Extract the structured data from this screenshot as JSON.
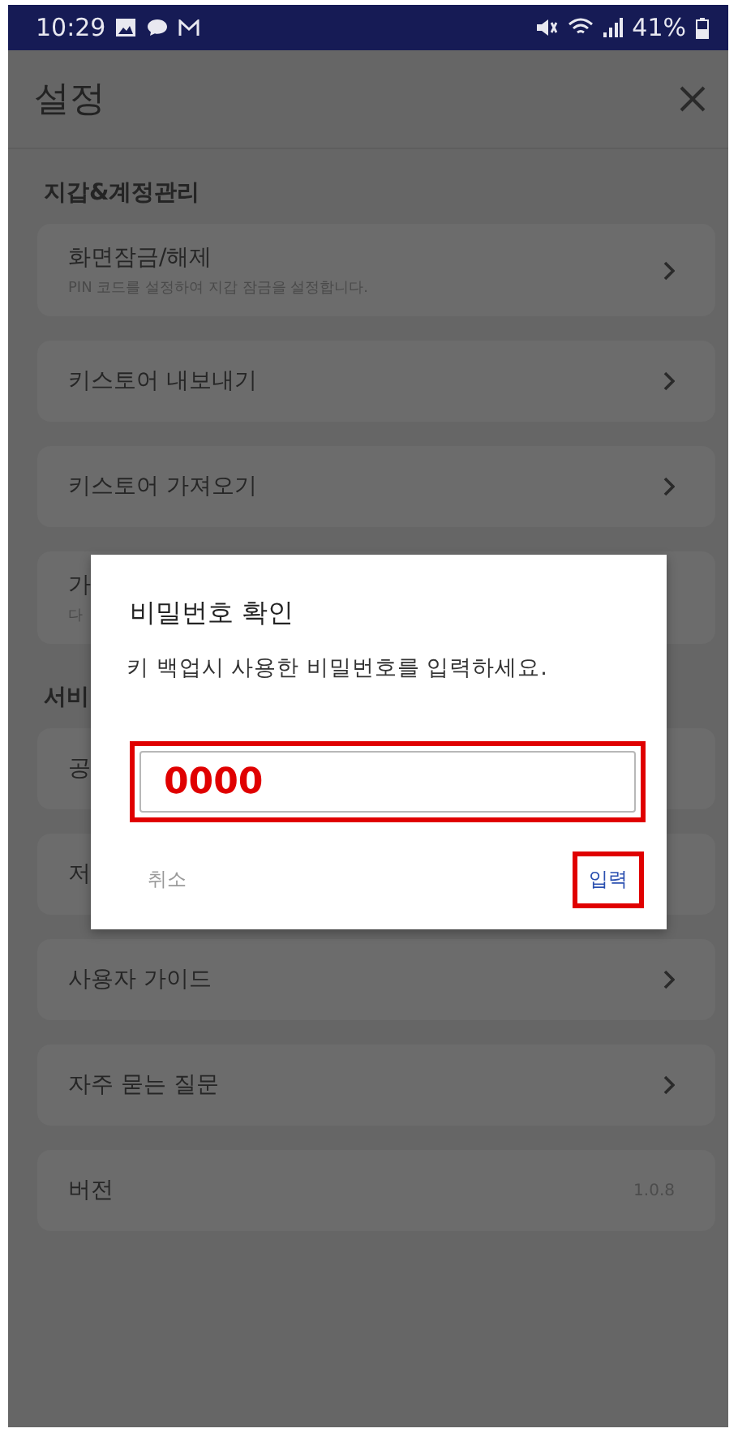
{
  "status_bar": {
    "time": "10:29",
    "battery": "41%"
  },
  "header": {
    "title": "설정"
  },
  "sections": [
    {
      "title": "지갑&계정관리",
      "items": [
        {
          "kind": "nav",
          "label": "화면잠금/해제",
          "subtitle": "PIN 코드를 설정하여 지갑 잠금을 설정합니다."
        },
        {
          "kind": "nav",
          "label": "키스토어 내보내기"
        },
        {
          "kind": "nav",
          "label": "키스토어 가져오기"
        },
        {
          "kind": "covered",
          "label": "가",
          "subtitle": "다"
        }
      ]
    },
    {
      "title": "서비",
      "items": [
        {
          "kind": "covered",
          "label": "공"
        },
        {
          "kind": "covered",
          "label": "저"
        },
        {
          "kind": "nav",
          "label": "사용자 가이드"
        },
        {
          "kind": "nav",
          "label": "자주 묻는 질문"
        },
        {
          "kind": "value",
          "label": "버전",
          "value": "1.0.8"
        }
      ]
    }
  ],
  "dialog": {
    "title": "비밀번호 확인",
    "message": "키 백업시 사용한 비밀번호를 입력하세요.",
    "input": {
      "value": "0000",
      "highlighted": true
    },
    "buttons": [
      {
        "kind": "cancel",
        "label": "취소",
        "highlighted": false
      },
      {
        "kind": "confirm",
        "label": "입력",
        "highlighted": true
      }
    ]
  }
}
